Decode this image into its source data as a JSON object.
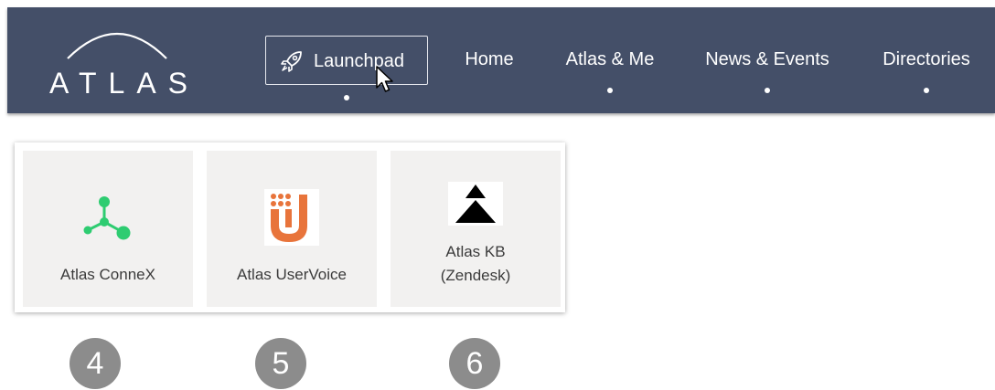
{
  "brand": {
    "logo_text": "ATLAS"
  },
  "nav": {
    "items": [
      {
        "label": "Launchpad",
        "icon": "rocket-icon",
        "active": true
      },
      {
        "label": "Home"
      },
      {
        "label": "Atlas & Me"
      },
      {
        "label": "News & Events"
      },
      {
        "label": "Directories"
      }
    ]
  },
  "launchpad": {
    "tiles": [
      {
        "label": "Atlas ConneX",
        "icon": "connex-network-icon",
        "color": "#2ecc71"
      },
      {
        "label": "Atlas UserVoice",
        "icon": "uservoice-icon",
        "color": "#e8743b"
      },
      {
        "label_line1": "Atlas KB",
        "label_line2": "(Zendesk)",
        "icon": "zendesk-triangle-icon"
      }
    ]
  },
  "callouts": [
    "4",
    "5",
    "6"
  ],
  "colors": {
    "navbar": "#444f68",
    "tile_bg": "#f2f1f0",
    "badge": "#8c8c8c"
  }
}
